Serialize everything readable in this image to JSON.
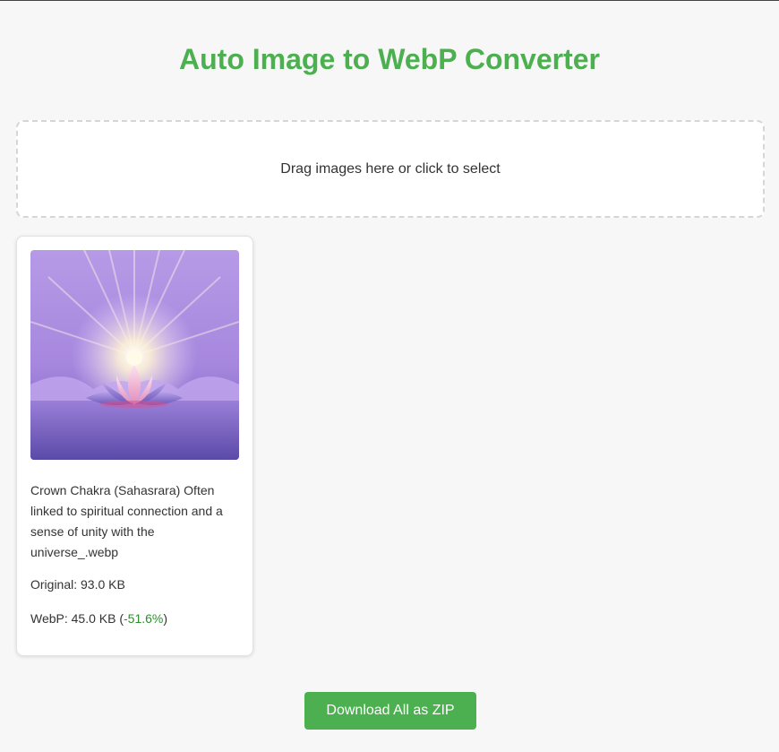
{
  "page": {
    "title": "Auto Image to WebP Converter",
    "accent_color": "#4caf50"
  },
  "dropzone": {
    "label": "Drag images here or click to select"
  },
  "results": [
    {
      "filename": "Crown Chakra (Sahasrara) Often linked to spiritual connection and a sense of unity with the universe_.webp",
      "thumbnail": "lotus-light-image",
      "original_label": "Original: 93.0 KB",
      "webp_prefix": "WebP: 45.0 KB (",
      "webp_change": "-51.6%",
      "webp_suffix": ")",
      "change_color": "#2e8b2e"
    }
  ],
  "actions": {
    "download_zip_label": "Download All as ZIP"
  }
}
